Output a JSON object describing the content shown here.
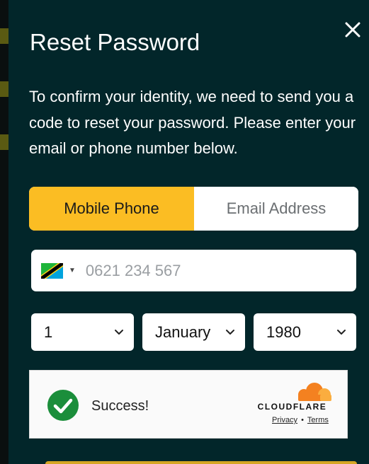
{
  "modal": {
    "title": "Reset Password",
    "description": "To confirm your identity, we need to send you a code to reset your password. Please enter your email or phone number below."
  },
  "tabs": [
    {
      "label": "Mobile Phone",
      "active": true
    },
    {
      "label": "Email Address",
      "active": false
    }
  ],
  "phone": {
    "country_flag": "tanzania-flag-icon",
    "placeholder": "0621 234 567",
    "value": ""
  },
  "dob": {
    "day": "1",
    "month": "January",
    "year": "1980"
  },
  "captcha": {
    "status": "Success!",
    "brand": "CLOUDFLARE",
    "privacy_label": "Privacy",
    "separator": "•",
    "terms_label": "Terms"
  },
  "colors": {
    "modal_bg": "#02262a",
    "accent": "#fbbd23",
    "success": "#1b8e3b",
    "cloudflare_orange": "#f48120"
  },
  "icons": {
    "close": "close-icon",
    "chevron": "chevron-down-icon",
    "success": "check-circle-icon",
    "cloud": "cloudflare-cloud-icon"
  }
}
